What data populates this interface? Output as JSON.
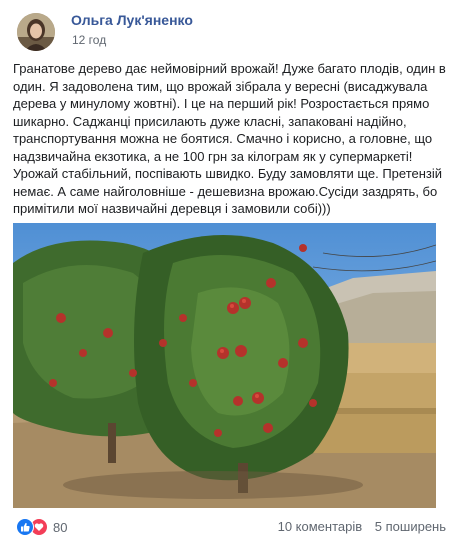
{
  "post": {
    "author": "Ольга Лук'яненко",
    "time": "12 год",
    "text_lines": [
      "Гранатове дерево дає неймовірний врожай! Дуже багато плодів, один  в",
      "один. Я задоволена тим, що врожай зібрала у вересні (висаджувала",
      "дерева у минулому жовтні). І це на перший рік! Розростається прямо",
      "шикарно. Саджанці присилають дуже класні, запаковані надійно,",
      "транспортування можна не боятися. Смачно і корисно, а головне, що",
      "надзвичайна екзотика,  а не 100 грн за кілограм як у супермаркеті!",
      "Урожай стабільний, поспівають швидко. Буду замовляти ще. Претензій",
      "немає. А саме найголовніше - дешевизна врожаю.Сусіди заздрять,  бо",
      "примітили мої назвичайні деревця і замовили собі)))"
    ]
  },
  "photo": {
    "subject": "pomegranate-trees-with-fruit"
  },
  "footer": {
    "reaction_icons": [
      "like-icon",
      "love-icon"
    ],
    "reaction_count": "80",
    "comments": "10 коментарів",
    "shares": "5 поширень"
  },
  "colors": {
    "author": "#385898",
    "like": "#1877f2",
    "love": "#f33e58",
    "muted": "#606770"
  }
}
